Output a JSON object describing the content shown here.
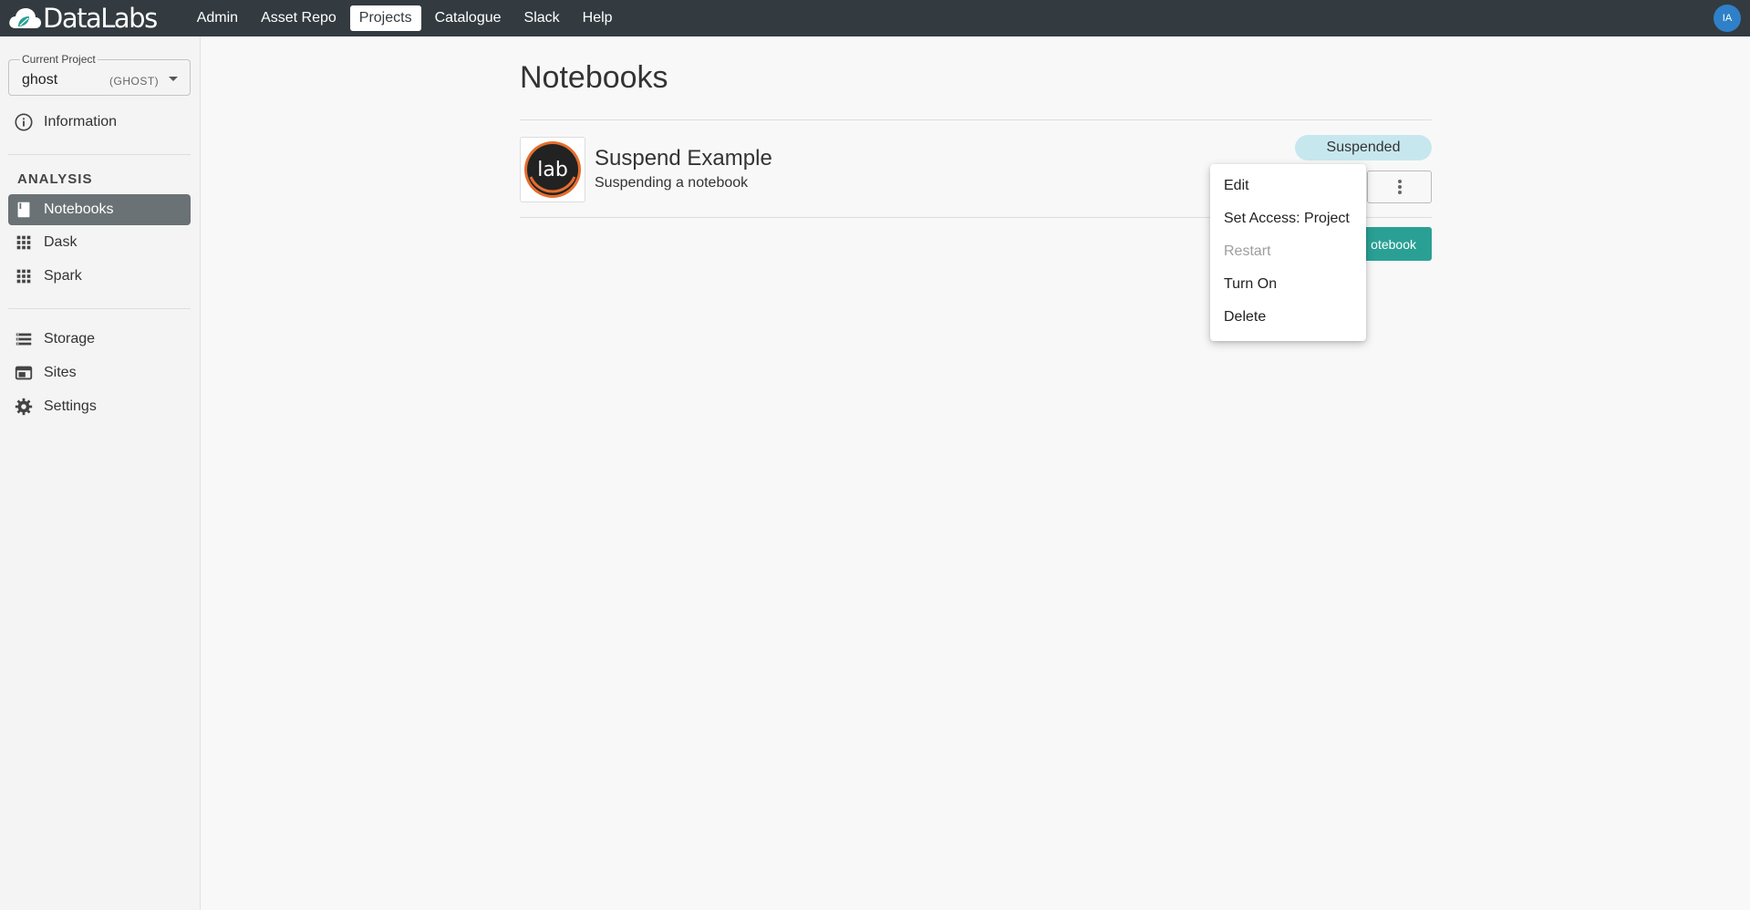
{
  "app": {
    "brand": "DataLabs",
    "user_initials": "IA"
  },
  "nav": {
    "items": [
      {
        "label": "Admin"
      },
      {
        "label": "Asset Repo"
      },
      {
        "label": "Projects",
        "active": true
      },
      {
        "label": "Catalogue"
      },
      {
        "label": "Slack"
      },
      {
        "label": "Help"
      }
    ]
  },
  "sidebar": {
    "project_label": "Current Project",
    "project_name": "ghost",
    "project_key": "(GHOST)",
    "information": "Information",
    "section_analysis": "ANALYSIS",
    "notebooks": "Notebooks",
    "dask": "Dask",
    "spark": "Spark",
    "storage": "Storage",
    "sites": "Sites",
    "settings": "Settings"
  },
  "main": {
    "title": "Notebooks",
    "notebook": {
      "logo_text": "lab",
      "name": "Suspend Example",
      "description": "Suspending a notebook",
      "status": "Suspended"
    },
    "create_button": "otebook"
  },
  "menu": {
    "edit": "Edit",
    "set_access": "Set Access: Project",
    "restart": "Restart",
    "turn_on": "Turn On",
    "delete": "Delete"
  },
  "colors": {
    "topbar": "#333b40",
    "accent": "#2aa095",
    "status_badge": "#c7e7ef",
    "avatar": "#2f80c8"
  }
}
